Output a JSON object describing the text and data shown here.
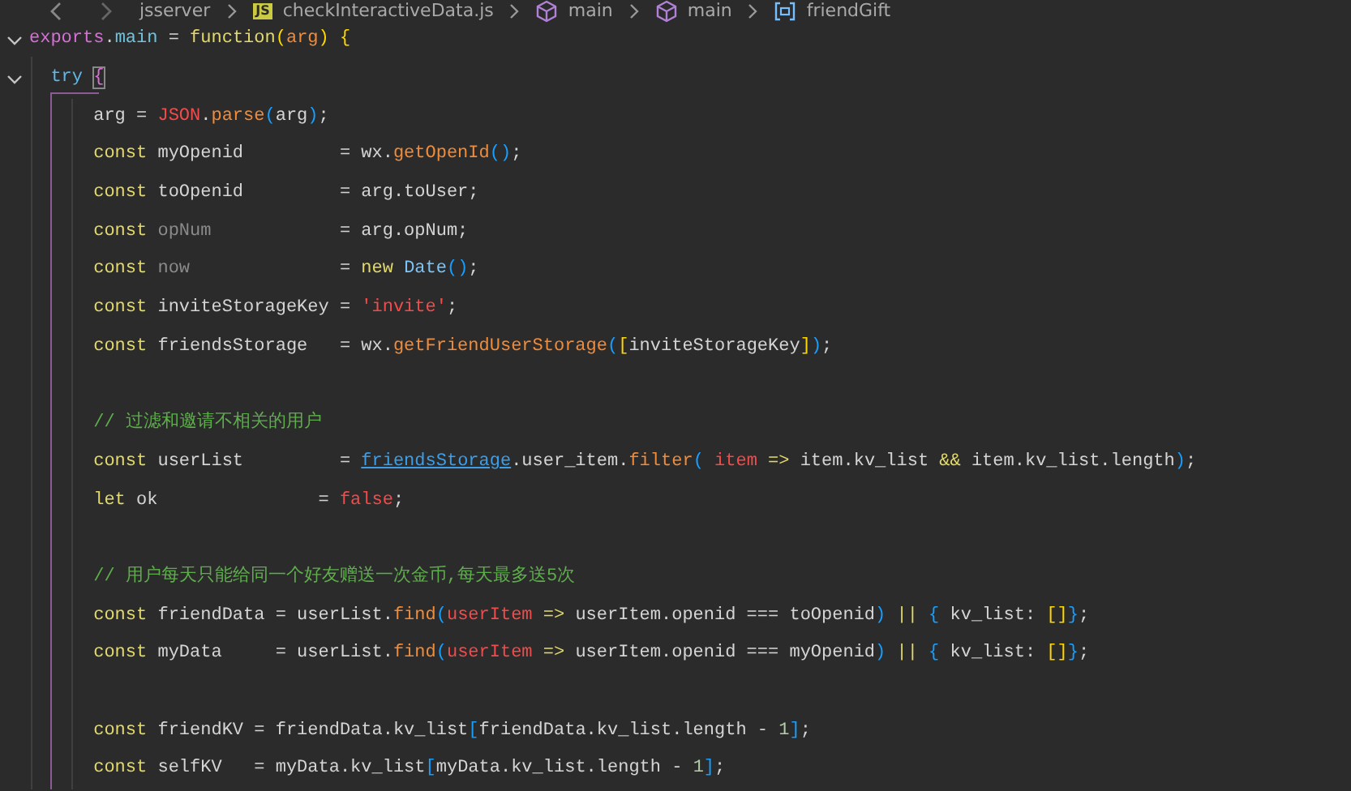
{
  "breadcrumb": {
    "crumbs": [
      {
        "text": "jsserver",
        "kind": "folder"
      },
      {
        "text": "checkInteractiveData.js",
        "kind": "file",
        "badge": "JS"
      },
      {
        "text": "main",
        "kind": "module"
      },
      {
        "text": "main",
        "kind": "module"
      },
      {
        "text": "friendGift",
        "kind": "variable"
      }
    ]
  },
  "editor": {
    "lines": [
      {
        "kind": "code",
        "expanded": true,
        "tokens": [
          {
            "text": "exports",
            "kind": "object"
          },
          {
            "text": ".",
            "kind": "plain"
          },
          {
            "text": "main",
            "kind": "property"
          },
          {
            "text": " = ",
            "kind": "plain"
          },
          {
            "text": "function",
            "kind": "keyword"
          },
          {
            "text": "(",
            "kind": "bracket1"
          },
          {
            "text": "arg",
            "kind": "param"
          },
          {
            "text": ") ",
            "kind": "bracket1"
          },
          {
            "text": "{",
            "kind": "bracket1"
          }
        ]
      },
      {
        "kind": "code",
        "expanded": true,
        "tokens": [
          {
            "text": "  try ",
            "kind": "control"
          },
          {
            "text": "{",
            "kind": "bracket2-match"
          }
        ]
      },
      {
        "kind": "code",
        "tokens": [
          {
            "text": "      arg = ",
            "kind": "plain"
          },
          {
            "text": "JSON",
            "kind": "red"
          },
          {
            "text": ".",
            "kind": "plain"
          },
          {
            "text": "parse",
            "kind": "function"
          },
          {
            "text": "(",
            "kind": "bracket3"
          },
          {
            "text": "arg",
            "kind": "plain"
          },
          {
            "text": ")",
            "kind": "bracket3"
          },
          {
            "text": ";",
            "kind": "plain"
          }
        ]
      },
      {
        "kind": "code",
        "tokens": [
          {
            "text": "      const",
            "kind": "keyword"
          },
          {
            "text": " myOpenid         = wx.",
            "kind": "plain"
          },
          {
            "text": "getOpenId",
            "kind": "function"
          },
          {
            "text": "()",
            "kind": "bracket3"
          },
          {
            "text": ";",
            "kind": "plain"
          }
        ]
      },
      {
        "kind": "code",
        "tokens": [
          {
            "text": "      const",
            "kind": "keyword"
          },
          {
            "text": " toOpenid         = arg.toUser;",
            "kind": "plain"
          }
        ]
      },
      {
        "kind": "code",
        "tokens": [
          {
            "text": "      const ",
            "kind": "keyword"
          },
          {
            "text": "opNum",
            "kind": "unused"
          },
          {
            "text": "            = arg.opNum;",
            "kind": "plain"
          }
        ]
      },
      {
        "kind": "code",
        "tokens": [
          {
            "text": "      const ",
            "kind": "keyword"
          },
          {
            "text": "now",
            "kind": "unused"
          },
          {
            "text": "              = ",
            "kind": "plain"
          },
          {
            "text": "new ",
            "kind": "keyword"
          },
          {
            "text": "Date",
            "kind": "type"
          },
          {
            "text": "()",
            "kind": "bracket3"
          },
          {
            "text": ";",
            "kind": "plain"
          }
        ]
      },
      {
        "kind": "code",
        "tokens": [
          {
            "text": "      const",
            "kind": "keyword"
          },
          {
            "text": " inviteStorageKey = ",
            "kind": "plain"
          },
          {
            "text": "'invite'",
            "kind": "string"
          },
          {
            "text": ";",
            "kind": "plain"
          }
        ]
      },
      {
        "kind": "code",
        "tokens": [
          {
            "text": "      const",
            "kind": "keyword"
          },
          {
            "text": " friendsStorage   = wx.",
            "kind": "plain"
          },
          {
            "text": "getFriendUserStorage",
            "kind": "function"
          },
          {
            "text": "(",
            "kind": "bracket3"
          },
          {
            "text": "[",
            "kind": "bracket1"
          },
          {
            "text": "inviteStorageKey",
            "kind": "plain"
          },
          {
            "text": "]",
            "kind": "bracket1"
          },
          {
            "text": ")",
            "kind": "bracket3"
          },
          {
            "text": ";",
            "kind": "plain"
          }
        ]
      },
      {
        "kind": "blank"
      },
      {
        "kind": "code",
        "tokens": [
          {
            "text": "      // 过滤和邀请不相关的用户",
            "kind": "comment"
          }
        ]
      },
      {
        "kind": "code",
        "tokens": [
          {
            "text": "      const",
            "kind": "keyword"
          },
          {
            "text": " userList         = ",
            "kind": "plain"
          },
          {
            "text": "friendsStorage",
            "kind": "link"
          },
          {
            "text": ".user_item.",
            "kind": "plain"
          },
          {
            "text": "filter",
            "kind": "function"
          },
          {
            "text": "( ",
            "kind": "bracket3"
          },
          {
            "text": "item ",
            "kind": "red"
          },
          {
            "text": "=>",
            "kind": "keyword"
          },
          {
            "text": " item.kv_list ",
            "kind": "plain"
          },
          {
            "text": "&&",
            "kind": "keyword"
          },
          {
            "text": " item.kv_list.length",
            "kind": "plain"
          },
          {
            "text": ")",
            "kind": "bracket3"
          },
          {
            "text": ";",
            "kind": "plain"
          }
        ]
      },
      {
        "kind": "code",
        "tokens": [
          {
            "text": "      let",
            "kind": "keyword"
          },
          {
            "text": " ok               = ",
            "kind": "plain"
          },
          {
            "text": "false",
            "kind": "red"
          },
          {
            "text": ";",
            "kind": "plain"
          }
        ]
      },
      {
        "kind": "blank"
      },
      {
        "kind": "code",
        "tokens": [
          {
            "text": "      // 用户每天只能给同一个好友赠送一次金币,每天最多送5次",
            "kind": "comment"
          }
        ]
      },
      {
        "kind": "code",
        "tokens": [
          {
            "text": "      const",
            "kind": "keyword"
          },
          {
            "text": " friendData = userList.",
            "kind": "plain"
          },
          {
            "text": "find",
            "kind": "function"
          },
          {
            "text": "(",
            "kind": "bracket3"
          },
          {
            "text": "userItem ",
            "kind": "red"
          },
          {
            "text": "=>",
            "kind": "keyword"
          },
          {
            "text": " userItem.openid === toOpenid",
            "kind": "plain"
          },
          {
            "text": ") ",
            "kind": "bracket3"
          },
          {
            "text": "|| ",
            "kind": "keyword"
          },
          {
            "text": "{",
            "kind": "bracket3"
          },
          {
            "text": " kv_list: ",
            "kind": "plain"
          },
          {
            "text": "[]",
            "kind": "bracket1"
          },
          {
            "text": "}",
            "kind": "bracket3"
          },
          {
            "text": ";",
            "kind": "plain"
          }
        ]
      },
      {
        "kind": "code",
        "tokens": [
          {
            "text": "      const",
            "kind": "keyword"
          },
          {
            "text": " myData     = userList.",
            "kind": "plain"
          },
          {
            "text": "find",
            "kind": "function"
          },
          {
            "text": "(",
            "kind": "bracket3"
          },
          {
            "text": "userItem ",
            "kind": "red"
          },
          {
            "text": "=>",
            "kind": "keyword"
          },
          {
            "text": " userItem.openid === myOpenid",
            "kind": "plain"
          },
          {
            "text": ") ",
            "kind": "bracket3"
          },
          {
            "text": "|| ",
            "kind": "keyword"
          },
          {
            "text": "{",
            "kind": "bracket3"
          },
          {
            "text": " kv_list: ",
            "kind": "plain"
          },
          {
            "text": "[]",
            "kind": "bracket1"
          },
          {
            "text": "}",
            "kind": "bracket3"
          },
          {
            "text": ";",
            "kind": "plain"
          }
        ]
      },
      {
        "kind": "blank"
      },
      {
        "kind": "code",
        "tokens": [
          {
            "text": "      const",
            "kind": "keyword"
          },
          {
            "text": " friendKV = friendData.kv_list",
            "kind": "plain"
          },
          {
            "text": "[",
            "kind": "bracket3"
          },
          {
            "text": "friendData.kv_list.length - ",
            "kind": "plain"
          },
          {
            "text": "1",
            "kind": "number"
          },
          {
            "text": "]",
            "kind": "bracket3"
          },
          {
            "text": ";",
            "kind": "plain"
          }
        ]
      },
      {
        "kind": "code",
        "tokens": [
          {
            "text": "      const",
            "kind": "keyword"
          },
          {
            "text": " selfKV   = myData.kv_list",
            "kind": "plain"
          },
          {
            "text": "[",
            "kind": "bracket3"
          },
          {
            "text": "myData.kv_list.length - ",
            "kind": "plain"
          },
          {
            "text": "1",
            "kind": "number"
          },
          {
            "text": "]",
            "kind": "bracket3"
          },
          {
            "text": ";",
            "kind": "plain"
          }
        ]
      }
    ]
  }
}
